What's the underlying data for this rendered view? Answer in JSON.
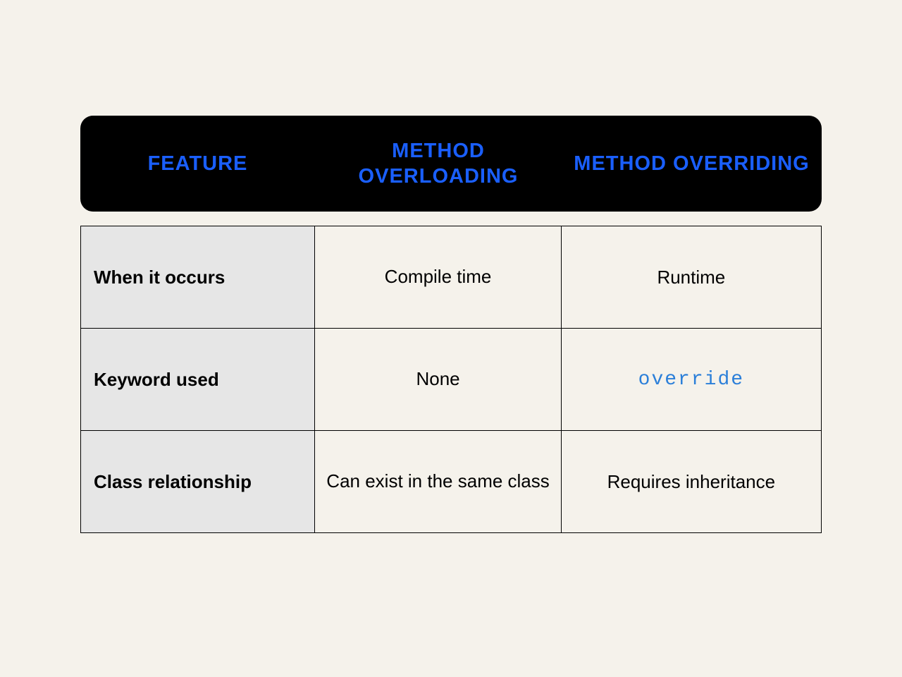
{
  "header": {
    "col1": "FEATURE",
    "col2": "METHOD OVERLOADING",
    "col3": "METHOD OVERRIDING"
  },
  "rows": [
    {
      "label": "When it occurs",
      "overloading": "Compile time",
      "overriding": "Runtime"
    },
    {
      "label": "Keyword used",
      "overloading": "None",
      "overriding": "override"
    },
    {
      "label": "Class relationship",
      "overloading": "Can exist in the same class",
      "overriding": "Requires inheritance"
    }
  ]
}
